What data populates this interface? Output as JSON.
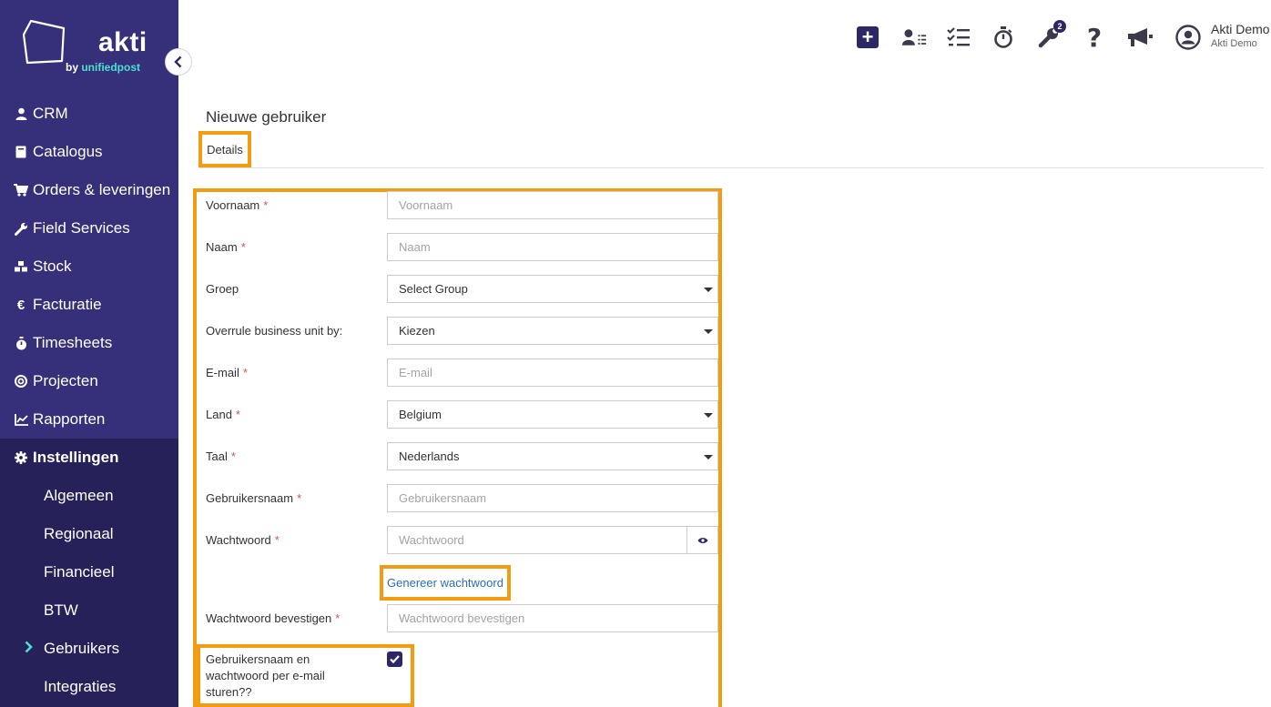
{
  "brand": {
    "name": "akti",
    "sub_by": "by ",
    "sub_name": "unifiedpost"
  },
  "sidebar": {
    "items": [
      {
        "label": "CRM",
        "icon": "user-icon"
      },
      {
        "label": "Catalogus",
        "icon": "book-icon"
      },
      {
        "label": "Orders & leveringen",
        "icon": "cart-icon"
      },
      {
        "label": "Field Services",
        "icon": "wrench-icon"
      },
      {
        "label": "Stock",
        "icon": "cubes-icon"
      },
      {
        "label": "Facturatie",
        "icon": "euro-icon"
      },
      {
        "label": "Timesheets",
        "icon": "stopwatch-icon"
      },
      {
        "label": "Projecten",
        "icon": "target-icon"
      },
      {
        "label": "Rapporten",
        "icon": "chart-icon"
      }
    ],
    "settings": {
      "label": "Instellingen",
      "icon": "gear-icon",
      "sub_items": [
        "Algemeen",
        "Regionaal",
        "Financieel",
        "BTW",
        "Gebruikers",
        "Integraties"
      ],
      "active": "Gebruikers"
    }
  },
  "topbar": {
    "notification_count": "2",
    "user_name": "Akti Demo",
    "user_company": "Akti Demo"
  },
  "page": {
    "title": "Nieuwe gebruiker",
    "tab": "Details"
  },
  "form": {
    "voornaam": {
      "label": "Voornaam",
      "placeholder": "Voornaam"
    },
    "naam": {
      "label": "Naam",
      "placeholder": "Naam"
    },
    "groep": {
      "label": "Groep",
      "value": "Select Group"
    },
    "business_unit": {
      "label": "Overrule business unit by:",
      "value": "Kiezen"
    },
    "email": {
      "label": "E-mail",
      "placeholder": "E-mail"
    },
    "land": {
      "label": "Land",
      "value": "Belgium"
    },
    "taal": {
      "label": "Taal",
      "value": "Nederlands"
    },
    "gebruikersnaam": {
      "label": "Gebruikersnaam",
      "placeholder": "Gebruikersnaam"
    },
    "wachtwoord": {
      "label": "Wachtwoord",
      "placeholder": "Wachtwoord"
    },
    "generate_link": "Genereer wachtwoord",
    "wachtwoord_bevestigen": {
      "label": "Wachtwoord bevestigen",
      "placeholder": "Wachtwoord bevestigen"
    },
    "send_email": {
      "label": "Gebruikersnaam en wachtwoord per e-mail sturen??",
      "checked": true
    }
  },
  "colors": {
    "sidebar": "#353079",
    "sidebar_dark": "#262259",
    "accent": "#4ce0d2",
    "highlight": "#f39c12",
    "link": "#2a6ebd"
  }
}
